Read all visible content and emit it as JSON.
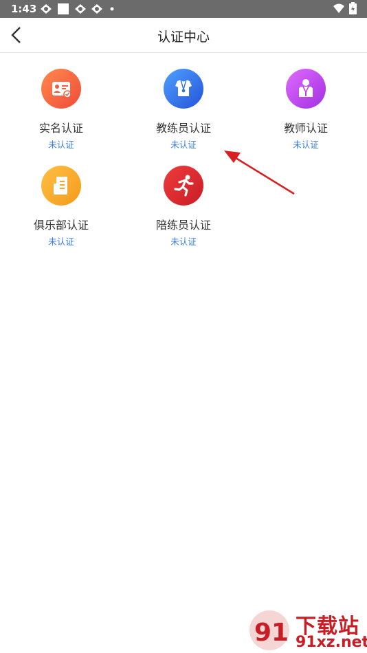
{
  "status_bar": {
    "time": "1:43"
  },
  "header": {
    "title": "认证中心"
  },
  "certifications": [
    {
      "label": "实名认证",
      "status": "未认证",
      "color": "#f0603d"
    },
    {
      "label": "教练员认证",
      "status": "未认证",
      "color": "#2f6fe6"
    },
    {
      "label": "教师认证",
      "status": "未认证",
      "color": "#c040e8"
    },
    {
      "label": "俱乐部认证",
      "status": "未认证",
      "color": "#f5a623"
    },
    {
      "label": "陪练员认证",
      "status": "未认证",
      "color": "#d8232a"
    }
  ],
  "watermark": {
    "brand_cn": "下载站",
    "brand_en": "91xz.net",
    "logo_text": "91"
  }
}
